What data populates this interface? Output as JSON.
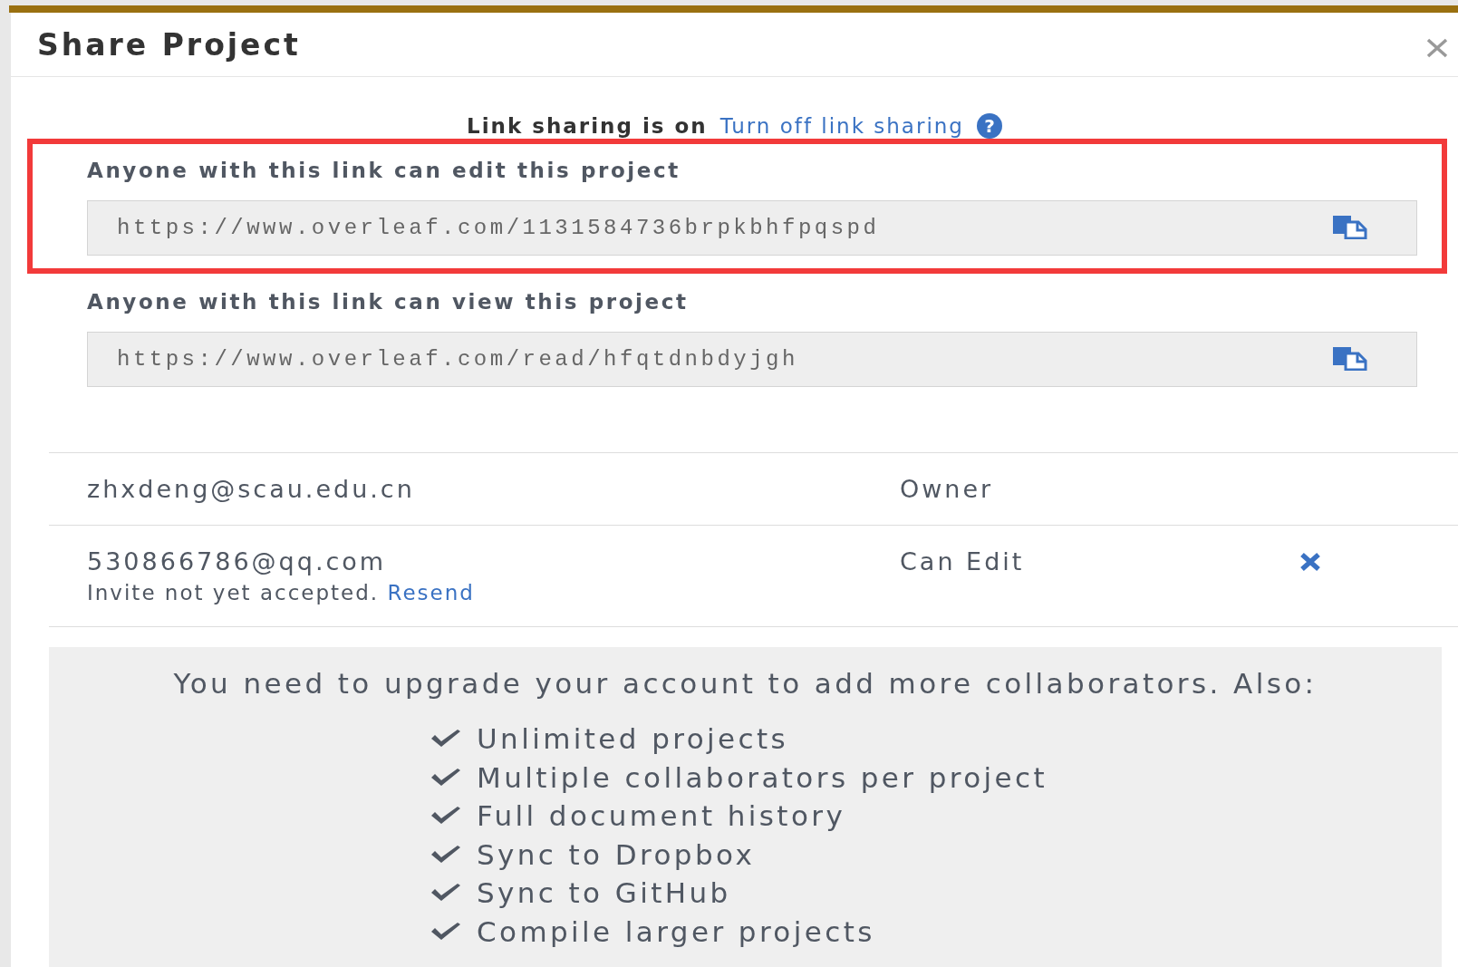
{
  "dialog": {
    "title": "Share Project"
  },
  "link_sharing": {
    "status": "Link sharing is on",
    "toggle_link": "Turn off link sharing",
    "help_glyph": "?"
  },
  "links": [
    {
      "label": "Anyone with this link can edit this project",
      "url": "https://www.overleaf.com/1131584736brpkbhfpqspd",
      "highlighted": true
    },
    {
      "label": "Anyone with this link can view this project",
      "url": "https://www.overleaf.com/read/hfqtdnbdyjgh",
      "highlighted": false
    }
  ],
  "collaborators": [
    {
      "email": "zhxdeng@scau.edu.cn",
      "role": "Owner",
      "removable": false
    },
    {
      "email": "530866786@qq.com",
      "role": "Can Edit",
      "note": "Invite not yet accepted.",
      "note_link": "Resend",
      "removable": true
    }
  ],
  "upgrade": {
    "message": "You need to upgrade your account to add more collaborators. Also:",
    "features": [
      "Unlimited projects",
      "Multiple collaborators per project",
      "Full document history",
      "Sync to Dropbox",
      "Sync to GitHub",
      "Compile larger projects"
    ]
  }
}
